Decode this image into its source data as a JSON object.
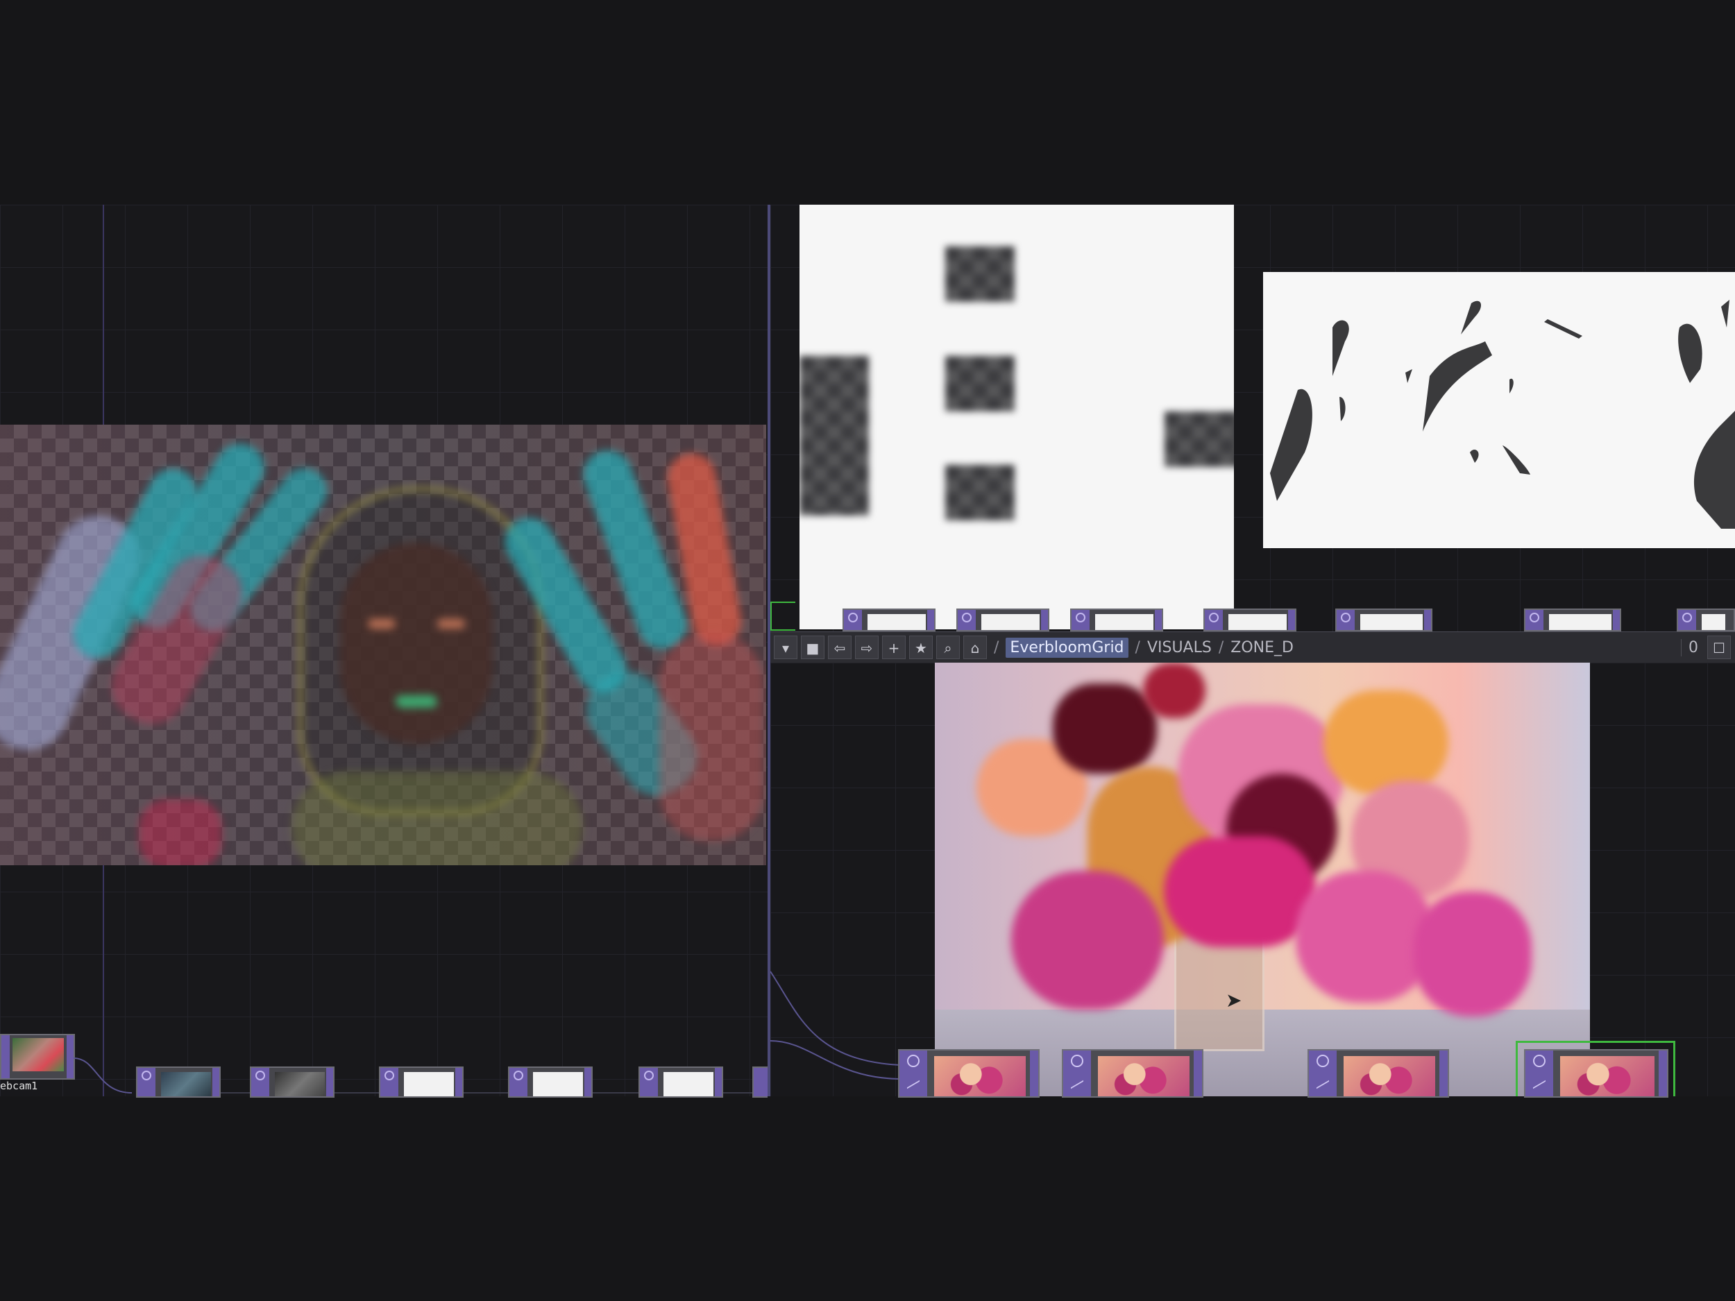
{
  "window": {
    "network_path": {
      "root": "/",
      "items": [
        "EverbloomGrid",
        "VISUALS",
        "ZONE_D"
      ],
      "separator": "/"
    },
    "frame_counter": "0"
  },
  "nodes": {
    "left_first_label": "ebcam1"
  },
  "icons": {
    "menu": "chevron-down-icon",
    "stop": "stop-icon",
    "back": "arrow-left-icon",
    "forward": "arrow-right-icon",
    "add": "plus-icon",
    "favorite": "star-icon",
    "search": "search-icon",
    "home": "home-icon",
    "maximize": "maximize-icon"
  },
  "colors": {
    "background": "#161618",
    "toolbar": "#2c2c31",
    "operator_flag": "#6a5aa8",
    "selected_node_border": "#3fb93f",
    "active_crumb": "#55608c"
  }
}
